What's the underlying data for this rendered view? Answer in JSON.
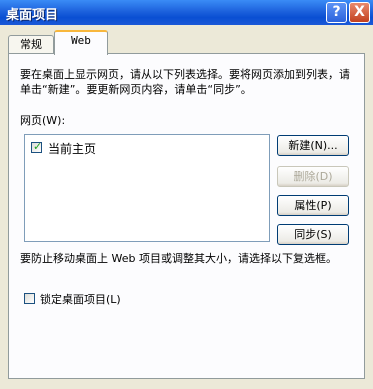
{
  "window": {
    "title": "桌面项目",
    "help_glyph": "?",
    "close_glyph": "X"
  },
  "tabs": [
    {
      "label": "常规",
      "active": false
    },
    {
      "label": "Web",
      "active": true
    }
  ],
  "web_tab": {
    "description": "要在桌面上显示网页，请从以下列表选择。要将网页添加到列表，请单击“新建”。要更新网页内容，请单击“同步”。",
    "list_label": "网页(W):",
    "web_pages": [
      {
        "label": "当前主页",
        "checked": true,
        "check_glyph": "✓"
      }
    ],
    "buttons": {
      "new": "新建(N)...",
      "delete": "删除(D)",
      "properties": "属性(P)",
      "sync": "同步(S)"
    },
    "delete_enabled": false,
    "lock_notice": "要防止移动桌面上 Web 项目或调整其大小，请选择以下复选框。",
    "lock_checkbox": {
      "label": "锁定桌面项目(L)",
      "checked": false
    }
  }
}
